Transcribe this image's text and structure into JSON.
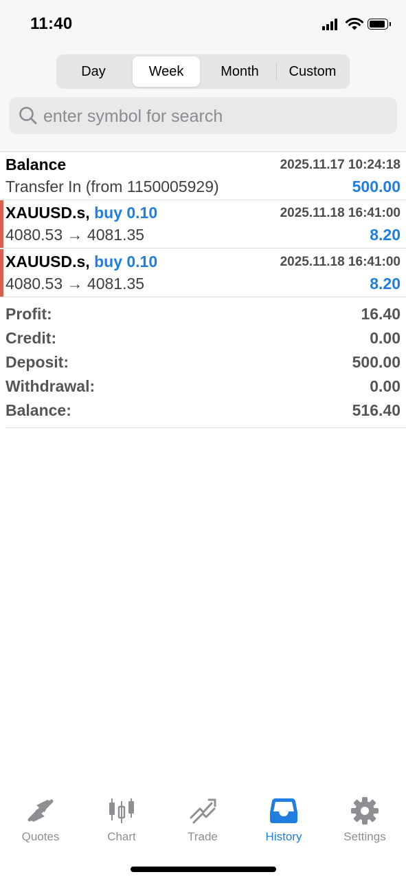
{
  "status_bar": {
    "time": "11:40"
  },
  "segments": [
    {
      "label": "Day",
      "active": false
    },
    {
      "label": "Week",
      "active": true
    },
    {
      "label": "Month",
      "active": false
    },
    {
      "label": "Custom",
      "active": false
    }
  ],
  "search": {
    "placeholder": "enter symbol for search",
    "value": ""
  },
  "rows": [
    {
      "title": "Balance",
      "datetime": "2025.11.17 10:24:18",
      "subtitle": "Transfer In (from 1150005929)",
      "value": "500.00"
    },
    {
      "symbol": "XAUUSD.s,",
      "side": "buy 0.10",
      "datetime": "2025.11.18 16:41:00",
      "price_open": "4080.53",
      "arrow": "→",
      "price_close": "4081.35",
      "value": "8.20"
    },
    {
      "symbol": "XAUUSD.s,",
      "side": "buy 0.10",
      "datetime": "2025.11.18 16:41:00",
      "price_open": "4080.53",
      "arrow": "→",
      "price_close": "4081.35",
      "value": "8.20"
    }
  ],
  "summary": [
    {
      "label": "Profit:",
      "value": "16.40"
    },
    {
      "label": "Credit:",
      "value": "0.00"
    },
    {
      "label": "Deposit:",
      "value": "500.00"
    },
    {
      "label": "Withdrawal:",
      "value": "0.00"
    },
    {
      "label": "Balance:",
      "value": "516.40"
    }
  ],
  "tabbar": [
    {
      "label": "Quotes",
      "icon": "quotes-icon",
      "active": false
    },
    {
      "label": "Chart",
      "icon": "chart-icon",
      "active": false
    },
    {
      "label": "Trade",
      "icon": "trade-icon",
      "active": false
    },
    {
      "label": "History",
      "icon": "history-icon",
      "active": true
    },
    {
      "label": "Settings",
      "icon": "settings-icon",
      "active": false
    }
  ],
  "colors": {
    "accent": "#1f7ee0",
    "trade_bar": "#d9604f",
    "inactive_tab": "#8e8e93"
  }
}
